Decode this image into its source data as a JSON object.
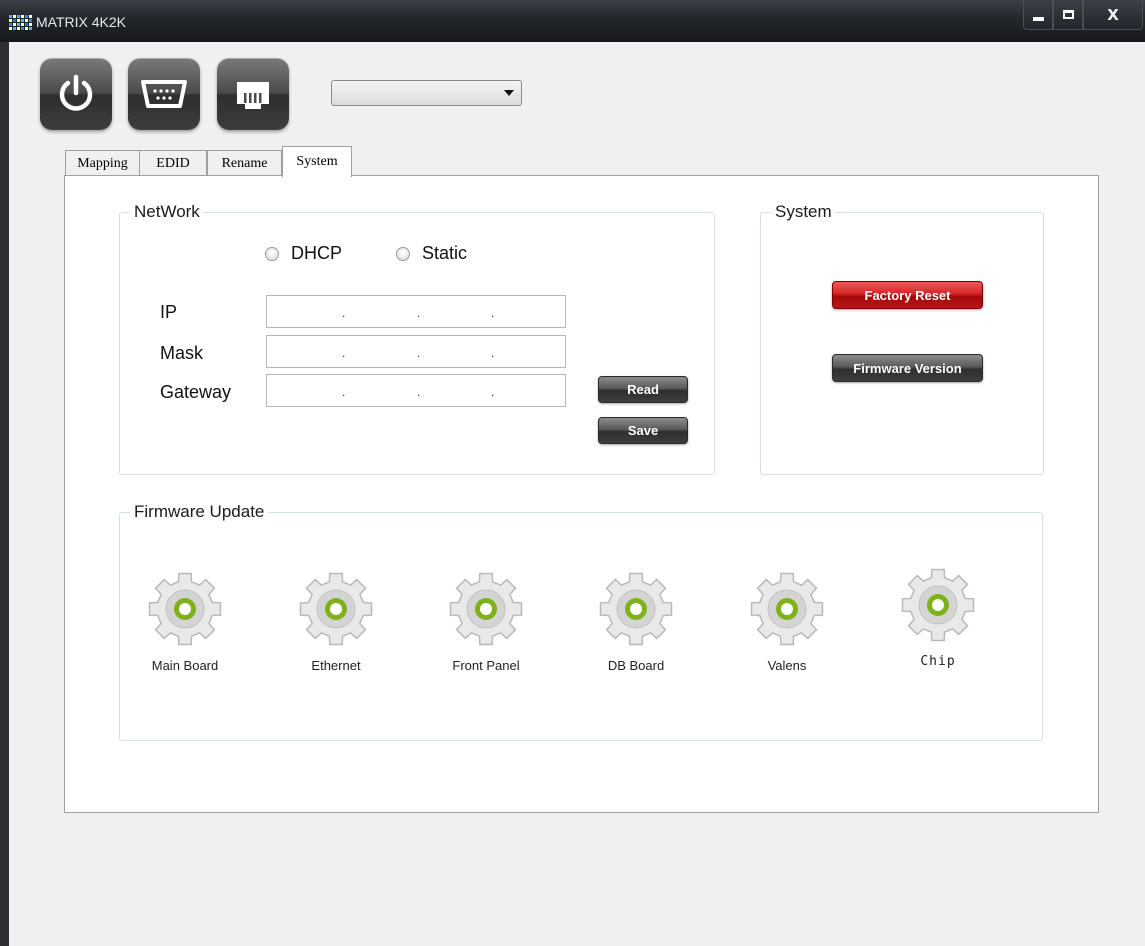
{
  "window": {
    "title": "MATRIX 4K2K",
    "controls": {
      "minimize": "minimize",
      "maximize": "maximize",
      "close": "X"
    }
  },
  "toolbar": {
    "buttons": [
      {
        "icon": "power-icon"
      },
      {
        "icon": "serial-port-icon"
      },
      {
        "icon": "ethernet-port-icon"
      }
    ],
    "dropdown": {
      "selected": ""
    }
  },
  "tabs": [
    "Mapping",
    "EDID",
    "Rename",
    "System"
  ],
  "active_tab": "System",
  "network": {
    "title": "NetWork",
    "modes": [
      "DHCP",
      "Static"
    ],
    "fields": [
      {
        "label": "IP",
        "value": ". . ."
      },
      {
        "label": "Mask",
        "value": ". . ."
      },
      {
        "label": "Gateway",
        "value": ". . ."
      }
    ],
    "dot": ".",
    "read_label": "Read",
    "save_label": "Save"
  },
  "system": {
    "title": "System",
    "factory_reset_label": "Factory Reset",
    "firmware_version_label": "Firmware Version"
  },
  "firmware_update": {
    "title": "Firmware Update",
    "items": [
      "Main Board",
      "Ethernet",
      "Front Panel",
      "DB Board",
      "Valens",
      "Chip"
    ]
  },
  "colors": {
    "accent_green": "#7fb21a",
    "danger_red": "#d42626",
    "button_dark": "#3e3e3e"
  }
}
